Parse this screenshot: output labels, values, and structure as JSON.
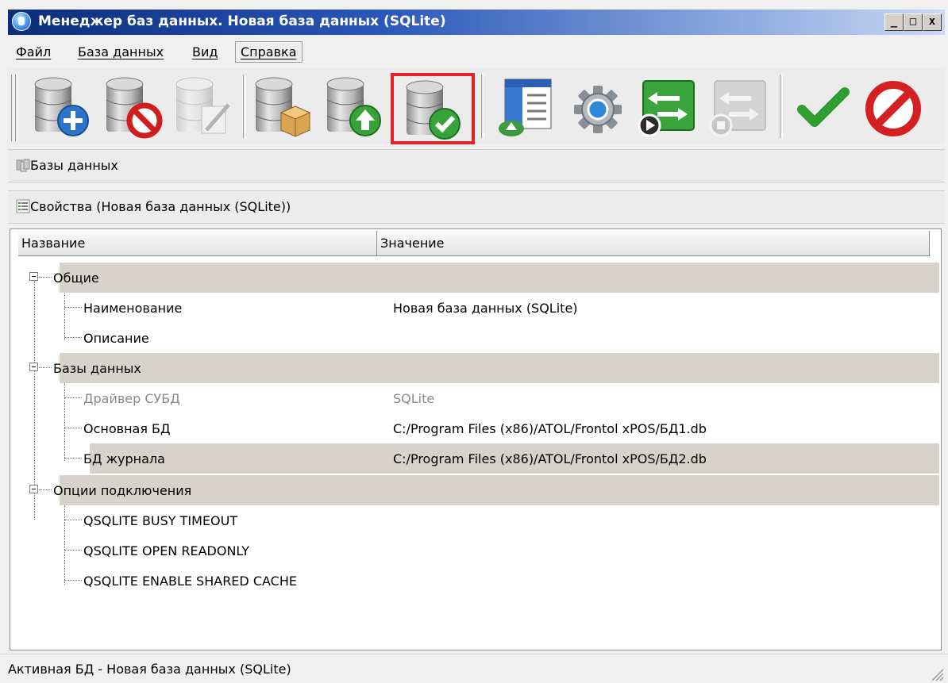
{
  "window": {
    "title": "Менеджер баз данных. Новая база данных (SQLite)",
    "controls": {
      "minimize": "_",
      "maximize": "□",
      "close": "x"
    }
  },
  "menu": {
    "items": [
      {
        "label": "Файл"
      },
      {
        "label": "База данных"
      },
      {
        "label": "Вид"
      },
      {
        "label": "Справка",
        "active": true
      }
    ]
  },
  "toolbar": {
    "buttons": [
      {
        "icon": "add-database-icon",
        "enabled": true
      },
      {
        "icon": "delete-database-icon",
        "enabled": true
      },
      {
        "icon": "edit-database-icon",
        "enabled": false
      },
      {
        "icon": "backup-database-icon",
        "enabled": true
      },
      {
        "icon": "upload-database-icon",
        "enabled": true
      },
      {
        "icon": "activate-database-icon",
        "enabled": true,
        "highlighted": true
      },
      {
        "icon": "window-form-icon",
        "enabled": true
      },
      {
        "icon": "settings-gear-icon",
        "enabled": true
      },
      {
        "icon": "export-arrows-icon",
        "enabled": true
      },
      {
        "icon": "import-arrows-icon",
        "enabled": false
      },
      {
        "icon": "check-icon",
        "enabled": true
      },
      {
        "icon": "cancel-icon",
        "enabled": true
      }
    ],
    "accent_highlight": "#e0242a"
  },
  "databases_panel": {
    "label": "Базы данных"
  },
  "properties_panel": {
    "label": "Свойства (Новая база данных (SQLite))"
  },
  "grid": {
    "columns": [
      "Название",
      "Значение"
    ],
    "rows": [
      {
        "type": "group",
        "name": "Общие"
      },
      {
        "type": "item",
        "name": "Наименование",
        "value": "Новая база данных (SQLite)"
      },
      {
        "type": "item",
        "name": "Описание",
        "value": ""
      },
      {
        "type": "group",
        "name": "Базы данных"
      },
      {
        "type": "item",
        "name": "Драйвер СУБД",
        "value": "SQLite",
        "disabled": true
      },
      {
        "type": "item",
        "name": "Основная БД",
        "value": "C:/Program Files (x86)/ATOL/Frontol xPOS/БД1.db"
      },
      {
        "type": "item",
        "name": "БД журнала",
        "value": "C:/Program Files (x86)/ATOL/Frontol xPOS/БД2.db",
        "selected": true
      },
      {
        "type": "group",
        "name": "Опции подключения"
      },
      {
        "type": "item",
        "name": "QSQLITE BUSY TIMEOUT",
        "value": ""
      },
      {
        "type": "item",
        "name": "QSQLITE OPEN READONLY",
        "value": ""
      },
      {
        "type": "item",
        "name": "QSQLITE ENABLE SHARED CACHE",
        "value": ""
      }
    ]
  },
  "status": {
    "text": "Активная БД - Новая база данных (SQLite)"
  },
  "colors": {
    "title_start": "#0b2d7a",
    "title_end": "#c9d9f2",
    "group_row_bg": "#d7d3cb",
    "selected_row_bg": "#d7d3cb",
    "disabled_text": "#8a8a8a"
  }
}
